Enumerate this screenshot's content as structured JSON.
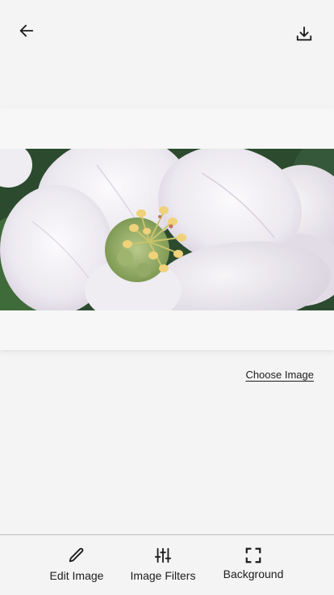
{
  "header": {
    "back_icon": "arrow-left-icon",
    "download_icon": "download-icon"
  },
  "main": {
    "image": {
      "subject": "white apple blossom",
      "colors": {
        "petal": "#f1eef3",
        "petal_shade": "#d9d3df",
        "stamen": "#f0d27a",
        "leaf": "#2f5a31"
      }
    },
    "choose_image_label": "Choose Image"
  },
  "toolbar": {
    "items": [
      {
        "label": "Edit Image",
        "icon": "pencil-icon"
      },
      {
        "label": "Image Filters",
        "icon": "sliders-icon"
      },
      {
        "label": "Background",
        "icon": "fullscreen-icon"
      }
    ]
  }
}
